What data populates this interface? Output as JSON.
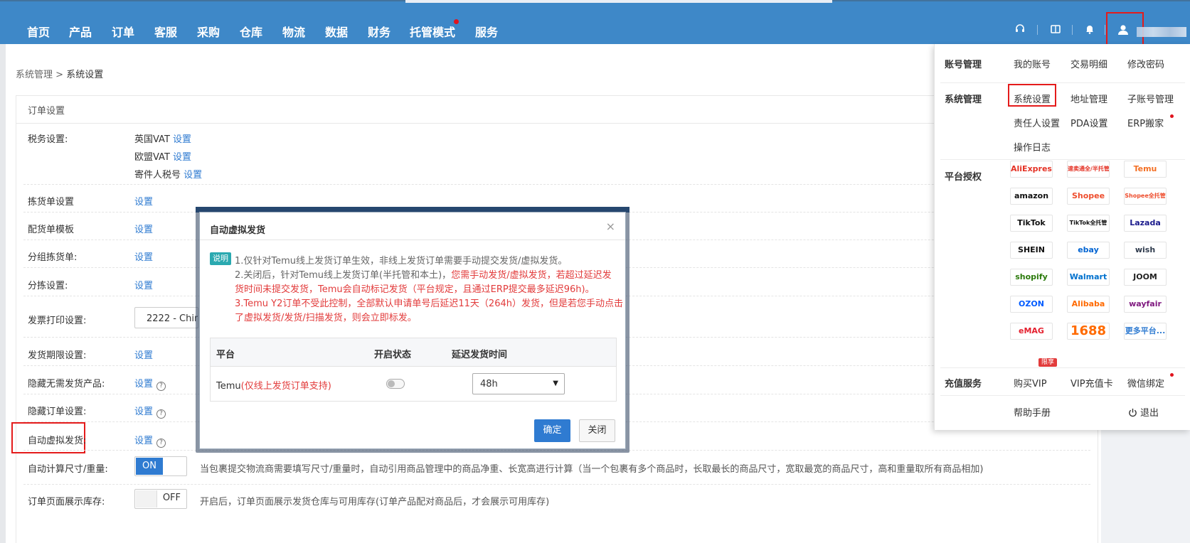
{
  "nav": {
    "items": [
      "首页",
      "产品",
      "订单",
      "客服",
      "采购",
      "仓库",
      "物流",
      "数据",
      "财务",
      "托管模式",
      "服务"
    ],
    "icons": [
      "headset-icon",
      "book-icon",
      "bell-icon",
      "user-icon"
    ]
  },
  "breadcrumb": {
    "parent": "系统管理",
    "sep": ">",
    "current": "系统设置"
  },
  "card": {
    "title": "订单设置"
  },
  "rows": {
    "tax": {
      "label": "税务设置:",
      "lines": [
        {
          "name": "英国VAT",
          "link": "设置"
        },
        {
          "name": "欧盟VAT",
          "link": "设置"
        },
        {
          "name": "寄件人税号",
          "link": "设置"
        }
      ]
    },
    "pick": {
      "label": "拣货单设置",
      "link": "设置"
    },
    "dist": {
      "label": "配货单模板",
      "link": "设置"
    },
    "group": {
      "label": "分组拣货单:",
      "link": "设置"
    },
    "sort": {
      "label": "分拣设置:",
      "link": "设置"
    },
    "invoice": {
      "label": "发票打印设置:",
      "select": "2222 - China"
    },
    "deadline": {
      "label": "发货期限设置:",
      "link": "设置"
    },
    "hide_products": {
      "label": "隐藏无需发货产品:",
      "link": "设置",
      "help": "?"
    },
    "hide_orders": {
      "label": "隐藏订单设置:",
      "link": "设置",
      "help": "?"
    },
    "auto_virtual": {
      "label": "自动虚拟发货:",
      "link": "设置",
      "help": "?"
    },
    "auto_size": {
      "label": "自动计算尺寸/重量:",
      "toggle": "ON",
      "desc": "当包裹提交物流商需要填写尺寸/重量时，自动引用商品管理中的商品净重、长宽高进行计算（当一个包裹有多个商品时，长取最长的商品尺寸，宽取最宽的商品尺寸，高和重量取所有商品相加)"
    },
    "show_stock": {
      "label": "订单页面展示库存:",
      "toggle": "OFF",
      "desc": "开启后，订单页面展示发货仓库与可用库存(订单产品配对商品后，才会展示可用库存)"
    }
  },
  "modal": {
    "title": "自动虚拟发货",
    "close": "×",
    "tag": "说明",
    "note1": "1.仅针对Temu线上发货订单生效，非线上发货订单需要手动提交发货/虚拟发货。",
    "note2a": "2.关闭后，针对Temu线上发货订单(半托管和本土)，",
    "note2b": "您需手动发货/虚拟发货，若超过延迟发",
    "note2c": "货时间未提交发货，Temu会自动标记发货（平台规定，且通过ERP提交最多延迟96h)。",
    "note3a": "3.Temu Y2订单不受此控制，全部默认申请单号后延迟11天（264h）发货，但是若您手动点击",
    "note3b": "了虚拟发货/发货/扫描发货，则会立即标发。",
    "headers": [
      "平台",
      "开启状态",
      "延迟发货时间"
    ],
    "row": {
      "platform": "Temu",
      "platform_note": "(仅线上发货订单支持)",
      "enabled": false,
      "delay": "48h"
    },
    "ok": "确定",
    "cancel": "关闭"
  },
  "dropdown": {
    "account": {
      "title": "账号管理",
      "items": [
        "我的账号",
        "交易明细",
        "修改密码"
      ]
    },
    "system": {
      "title": "系统管理",
      "items": [
        "系统设置",
        "地址管理",
        "子账号管理",
        "责任人设置",
        "PDA设置",
        "ERP搬家",
        "操作日志"
      ]
    },
    "platform": {
      "title": "平台授权",
      "logos": [
        "AliExpress",
        "速卖通全/半托管",
        "Temu",
        "amazon",
        "Shopee",
        "Shopee全托管",
        "TikTok",
        "TikTok全托管",
        "Lazada",
        "SHEIN",
        "ebay",
        "wish",
        "shopify",
        "Walmart",
        "JOOM",
        "OZON",
        "Alibaba",
        "wayfair",
        "eMAG",
        "1688",
        "更多平台..."
      ],
      "logo_colors": [
        "#e43225",
        "#e43225",
        "#f36f24",
        "#111111",
        "#ee4d2d",
        "#ee4d2d",
        "#111111",
        "#111111",
        "#1a1a8c",
        "#111111",
        "#0064d2",
        "#2f3b4d",
        "#2b7a0b",
        "#0071ce",
        "#222222",
        "#005bff",
        "#ff6a00",
        "#7f187f",
        "#e4202e",
        "#ff6a00",
        "#2f7bd1"
      ]
    },
    "recharge": {
      "title": "充值服务",
      "items": [
        "购买VIP",
        "VIP充值卡",
        "微信绑定"
      ],
      "vip_tag": "限享"
    },
    "help": "帮助手册",
    "logout": "退出"
  }
}
